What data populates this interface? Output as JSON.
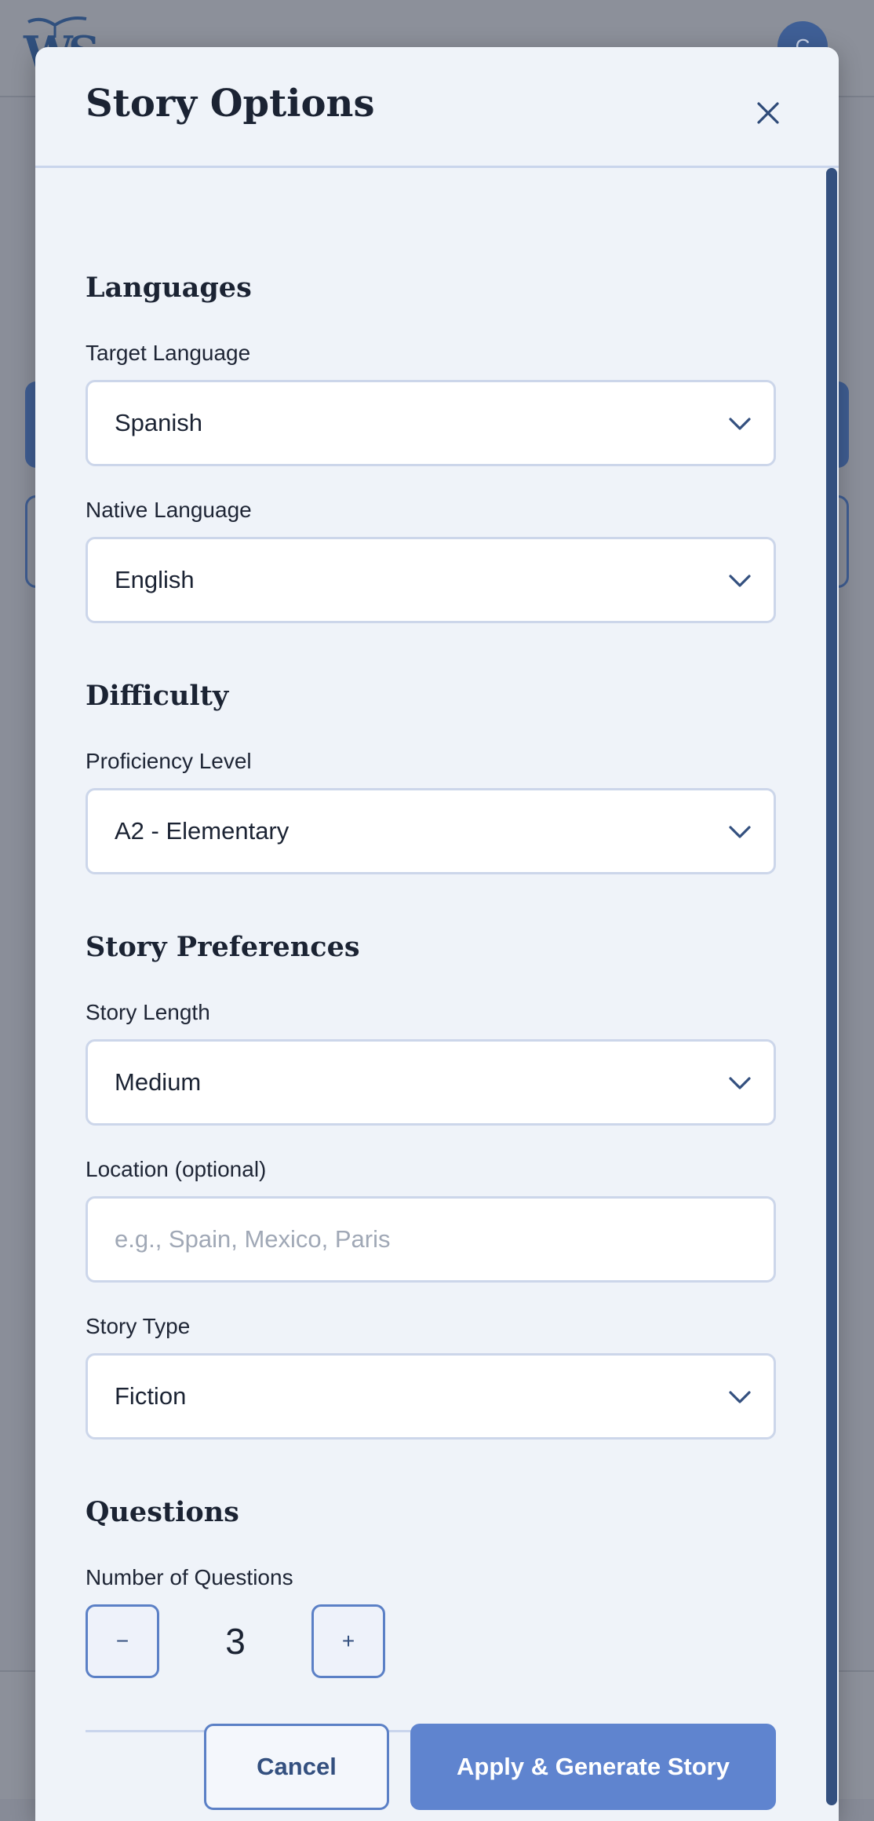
{
  "background": {
    "logo_text": "WS",
    "avatar_initial": "C"
  },
  "modal": {
    "title": "Story Options",
    "close_icon": "close-icon"
  },
  "sections": {
    "languages": {
      "title": "Languages",
      "target_label": "Target Language",
      "target_value": "Spanish",
      "native_label": "Native Language",
      "native_value": "English"
    },
    "difficulty": {
      "title": "Difficulty",
      "level_label": "Proficiency Level",
      "level_value": "A2 - Elementary"
    },
    "preferences": {
      "title": "Story Preferences",
      "length_label": "Story Length",
      "length_value": "Medium",
      "location_label": "Location (optional)",
      "location_placeholder": "e.g., Spain, Mexico, Paris",
      "type_label": "Story Type",
      "type_value": "Fiction"
    },
    "questions": {
      "title": "Questions",
      "count_label": "Number of Questions",
      "decrement": "−",
      "value": "3",
      "increment": "+"
    }
  },
  "actions": {
    "cancel": "Cancel",
    "apply": "Apply & Generate Story"
  },
  "colors": {
    "accent": "#5f84cf",
    "dark": "#34507f"
  }
}
